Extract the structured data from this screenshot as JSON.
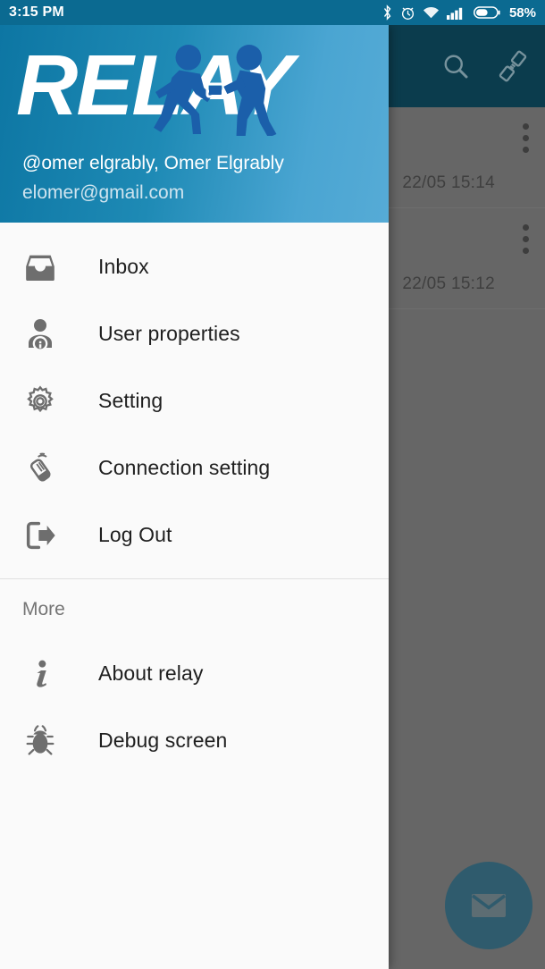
{
  "statusbar": {
    "time": "3:15 PM",
    "battery_percent": "58%",
    "icons": [
      "bluetooth-icon",
      "alarm-icon",
      "wifi-icon",
      "cellular-signal-icon",
      "battery-icon"
    ]
  },
  "drawer": {
    "logo_text": "RELAY",
    "logo_alt": "relay-runners-logo",
    "account": {
      "name": "@omer elgrably, Omer Elgrably",
      "email": "elomer@gmail.com"
    },
    "menu": [
      {
        "label": "Inbox",
        "icon": "inbox-icon"
      },
      {
        "label": "User properties",
        "icon": "user-info-icon"
      },
      {
        "label": "Setting",
        "icon": "gear-icon"
      },
      {
        "label": "Connection setting",
        "icon": "wireless-device-icon"
      },
      {
        "label": "Log Out",
        "icon": "logout-icon"
      }
    ],
    "more_section_label": "More",
    "more_items": [
      {
        "label": "About relay",
        "icon": "info-icon"
      },
      {
        "label": "Debug screen",
        "icon": "bug-icon"
      }
    ]
  },
  "background_app": {
    "toolbar": {
      "search_label": "search-icon",
      "share_label": "phone-share-icon"
    },
    "messages": [
      {
        "timestamp": "22/05  15:14",
        "overflow_label": "more-options"
      },
      {
        "timestamp": "22/05  15:12",
        "overflow_label": "more-options"
      }
    ],
    "fab_label": "compose-message"
  },
  "colors": {
    "status_bar": "#0b6a91",
    "toolbar": "#0b3c4d",
    "scrim": "#666666",
    "drawer_bg": "#fafafa",
    "header_gradient_start": "#0d76a3",
    "header_gradient_end": "#56abd6",
    "logo_figure": "#1b5faa",
    "icon_gray": "#6e6e6e",
    "label_text": "#1f1f1f",
    "muted_text": "#757575"
  }
}
